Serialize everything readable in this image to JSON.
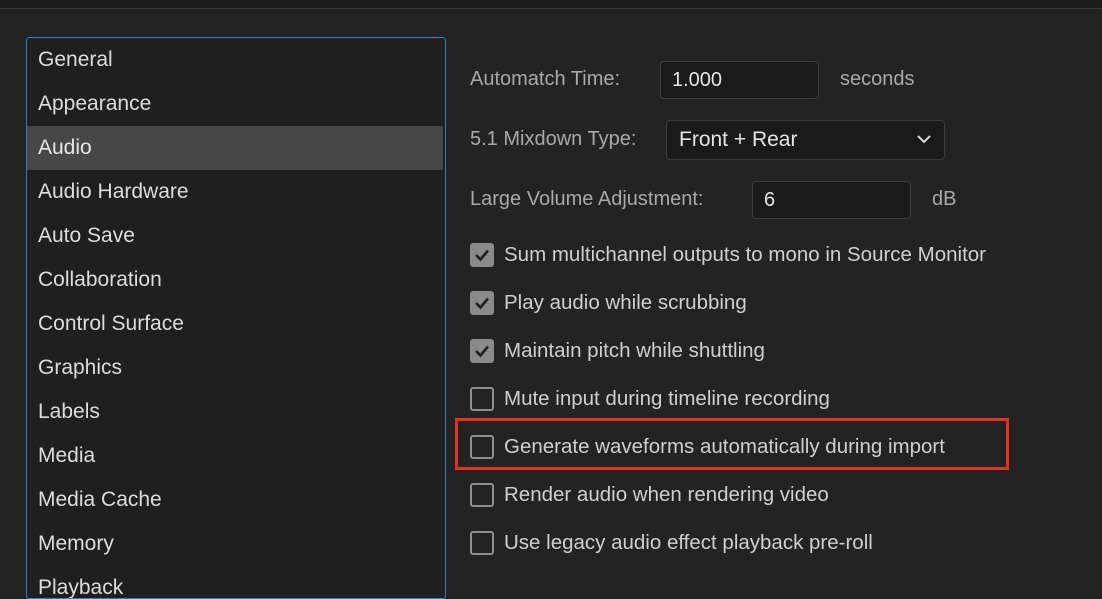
{
  "sidebar": {
    "items": [
      {
        "label": "General",
        "selected": false
      },
      {
        "label": "Appearance",
        "selected": false
      },
      {
        "label": "Audio",
        "selected": true
      },
      {
        "label": "Audio Hardware",
        "selected": false
      },
      {
        "label": "Auto Save",
        "selected": false
      },
      {
        "label": "Collaboration",
        "selected": false
      },
      {
        "label": "Control Surface",
        "selected": false
      },
      {
        "label": "Graphics",
        "selected": false
      },
      {
        "label": "Labels",
        "selected": false
      },
      {
        "label": "Media",
        "selected": false
      },
      {
        "label": "Media Cache",
        "selected": false
      },
      {
        "label": "Memory",
        "selected": false
      },
      {
        "label": "Playback",
        "selected": false
      }
    ]
  },
  "audio": {
    "automatch_time": {
      "label": "Automatch Time:",
      "value": "1.000",
      "unit": "seconds"
    },
    "mixdown_type": {
      "label": "5.1 Mixdown Type:",
      "value": "Front + Rear"
    },
    "large_volume": {
      "label": "Large Volume Adjustment:",
      "value": "6",
      "unit": "dB"
    },
    "options": [
      {
        "label": "Sum multichannel outputs to mono in Source Monitor",
        "checked": true
      },
      {
        "label": "Play audio while scrubbing",
        "checked": true
      },
      {
        "label": "Maintain pitch while shuttling",
        "checked": true
      },
      {
        "label": "Mute input during timeline recording",
        "checked": false
      },
      {
        "label": "Generate waveforms automatically during import",
        "checked": false
      },
      {
        "label": "Render audio when rendering video",
        "checked": false
      },
      {
        "label": "Use legacy audio effect playback pre-roll",
        "checked": false
      }
    ]
  },
  "colors": {
    "selection_border": "#2d7fd0",
    "highlight": "#e4321f",
    "selected_item_bg": "#474747"
  }
}
